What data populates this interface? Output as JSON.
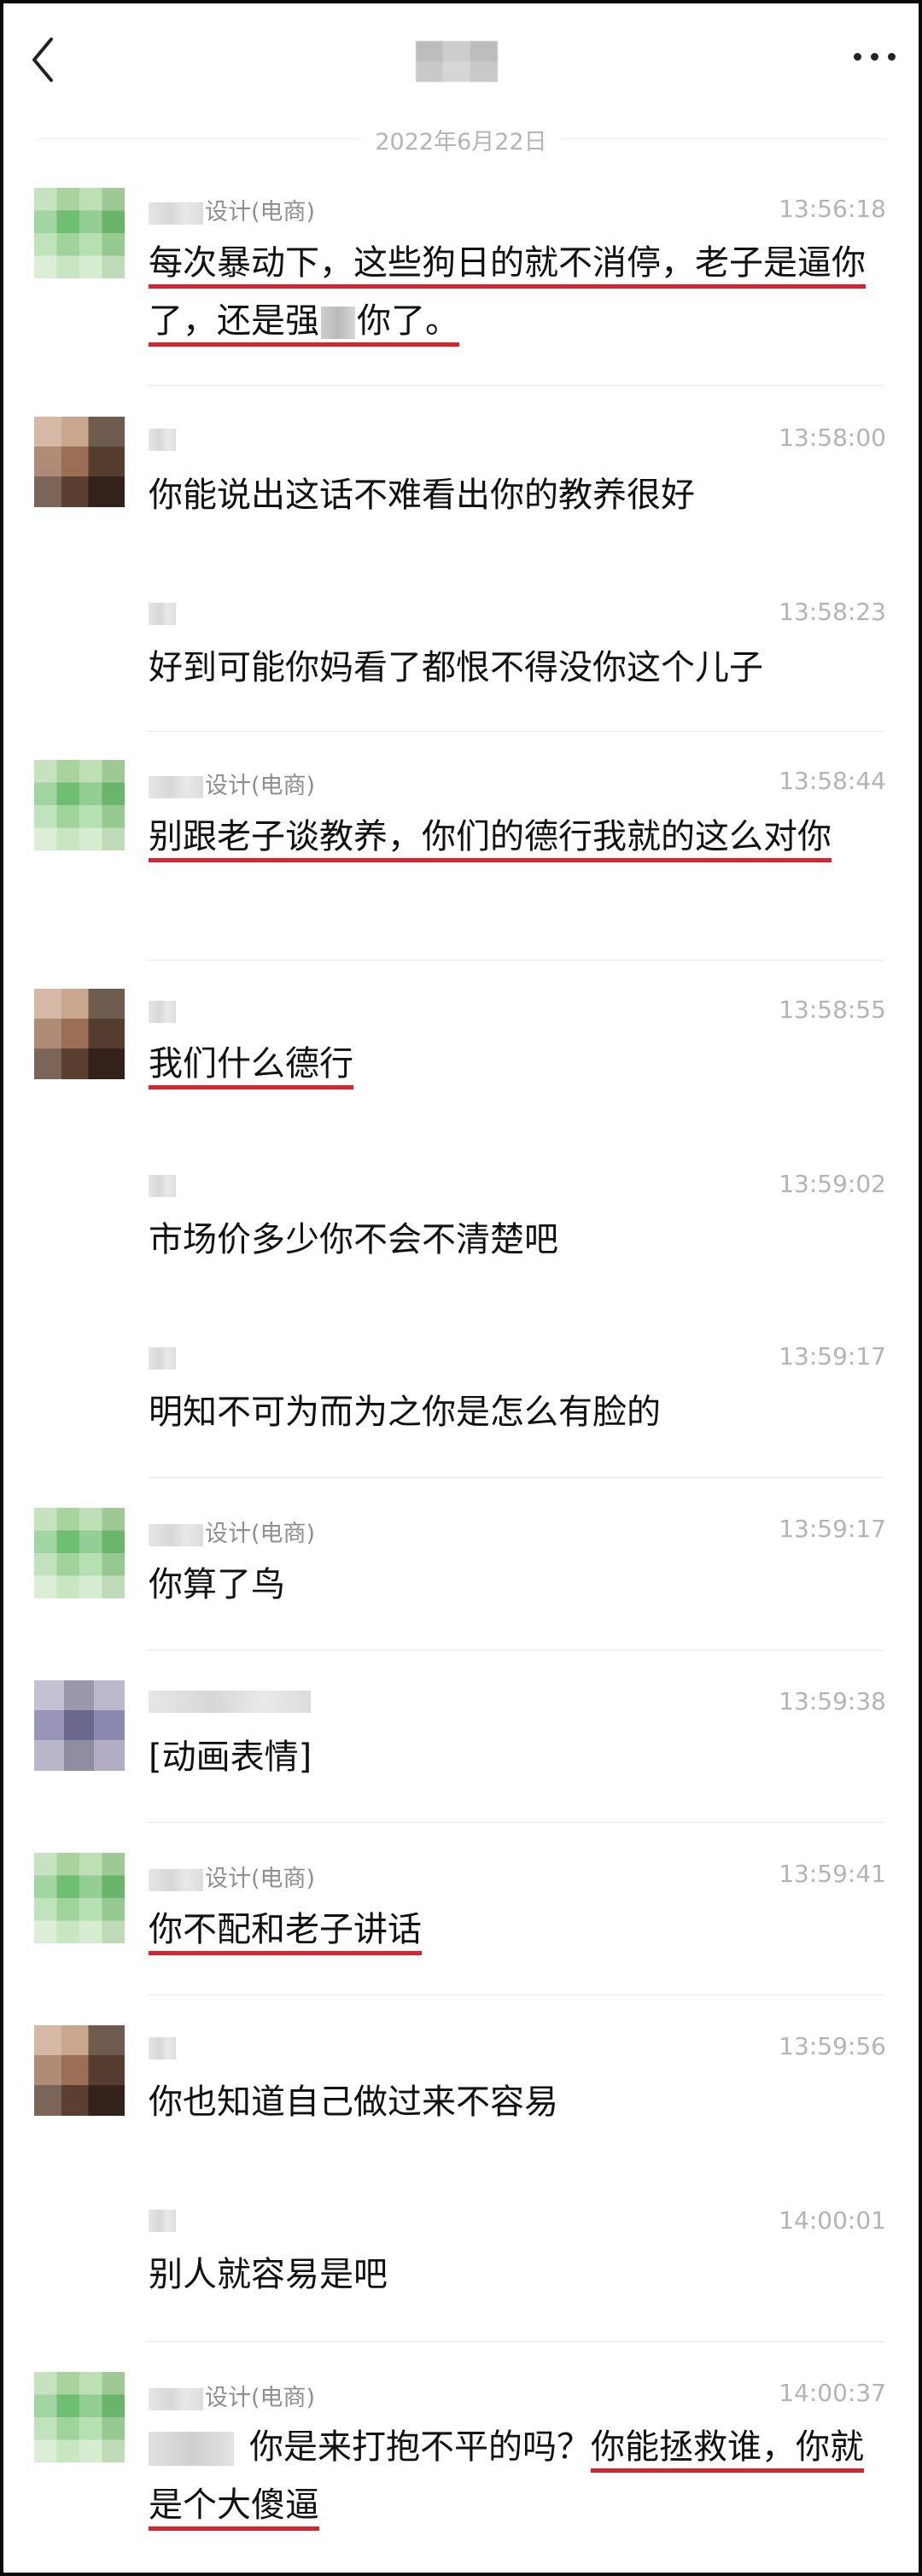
{
  "header": {
    "title": "",
    "back_icon": "chevron-left-icon",
    "more_icon": "more-horizontal-icon"
  },
  "date_separator": "2022年6月22日",
  "messages": [
    {
      "sender_suffix": "设计(电商)",
      "time": "13:56:18",
      "segments": [
        "每次暴动下，这些狗日的就不消停，老子是逼你了，还是强",
        "你了。"
      ]
    },
    {
      "sender_suffix": "",
      "time": "13:58:00",
      "text": "你能说出这话不难看出你的教养很好"
    },
    {
      "sender_suffix": "",
      "time": "13:58:23",
      "text": "好到可能你妈看了都恨不得没你这个儿子"
    },
    {
      "sender_suffix": "设计(电商)",
      "time": "13:58:44",
      "text": "别跟老子谈教养，你们的德行我就的这么对你"
    },
    {
      "sender_suffix": "",
      "time": "13:58:55",
      "text": "我们什么德行"
    },
    {
      "sender_suffix": "",
      "time": "13:59:02",
      "text": "市场价多少你不会不清楚吧"
    },
    {
      "sender_suffix": "",
      "time": "13:59:17",
      "text": "明知不可为而为之你是怎么有脸的"
    },
    {
      "sender_suffix": "设计(电商)",
      "time": "13:59:17",
      "text": "你算了鸟"
    },
    {
      "sender_suffix": "",
      "time": "13:59:38",
      "text": "[动画表情]"
    },
    {
      "sender_suffix": "设计(电商)",
      "time": "13:59:41",
      "text": "你不配和老子讲话"
    },
    {
      "sender_suffix": "",
      "time": "13:59:56",
      "text": "你也知道自己做过来不容易"
    },
    {
      "sender_suffix": "",
      "time": "14:00:01",
      "text": "别人就容易是吧"
    },
    {
      "sender_suffix": "设计(电商)",
      "time": "14:00:37",
      "segments": [
        "你是来打抱不平的吗？",
        "你能拯救谁，",
        "你就是个大傻逼"
      ]
    }
  ]
}
